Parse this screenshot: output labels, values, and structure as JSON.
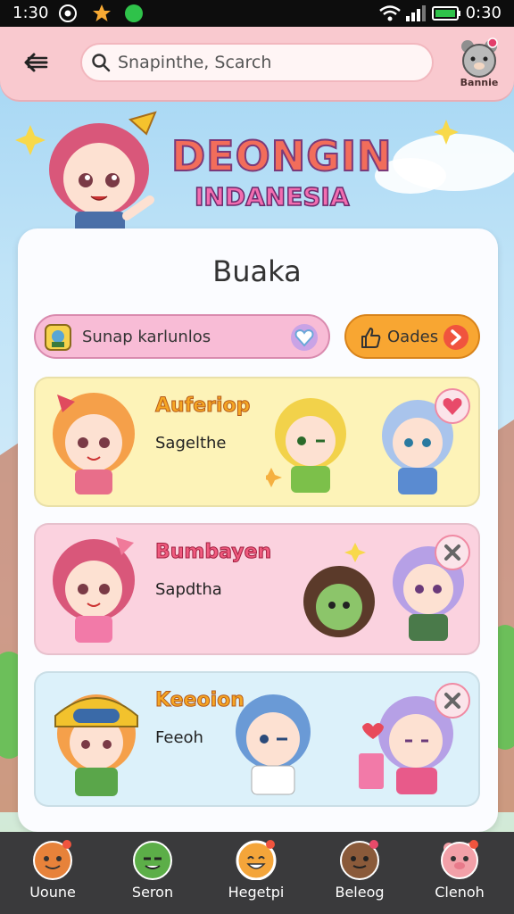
{
  "status_bar": {
    "time_left": "1:30",
    "time_right": "0:30"
  },
  "header": {
    "search_placeholder": "Snapinthe, Scarch",
    "avatar_label": "Bannie"
  },
  "hero": {
    "title_line1": "DEONGIN",
    "title_line2": "INDANESIA"
  },
  "panel": {
    "title": "Buaka",
    "filter_label": "Sunap karlunlos",
    "orange_button_label": "Oades"
  },
  "rows": [
    {
      "name": "Auferiop",
      "subtitle": "Sagelthe",
      "action_icon": "heart-icon"
    },
    {
      "name": "Bumbayen",
      "subtitle": "Sapdtha",
      "action_icon": "close-icon"
    },
    {
      "name": "Keeoion",
      "subtitle": "Feeoh",
      "action_icon": "close-icon"
    }
  ],
  "nav": [
    {
      "label": "Uoune",
      "color": "#e7823a"
    },
    {
      "label": "Seron",
      "color": "#5cae48"
    },
    {
      "label": "Hegetpi",
      "color": "#f4a53a"
    },
    {
      "label": "Beleog",
      "color": "#8a5a3a"
    },
    {
      "label": "Clenoh",
      "color": "#f2a0a8"
    }
  ],
  "colors": {
    "accent_pink": "#f9c9cf",
    "accent_orange": "#f8a632",
    "nav_background": "#3a3a3c"
  }
}
